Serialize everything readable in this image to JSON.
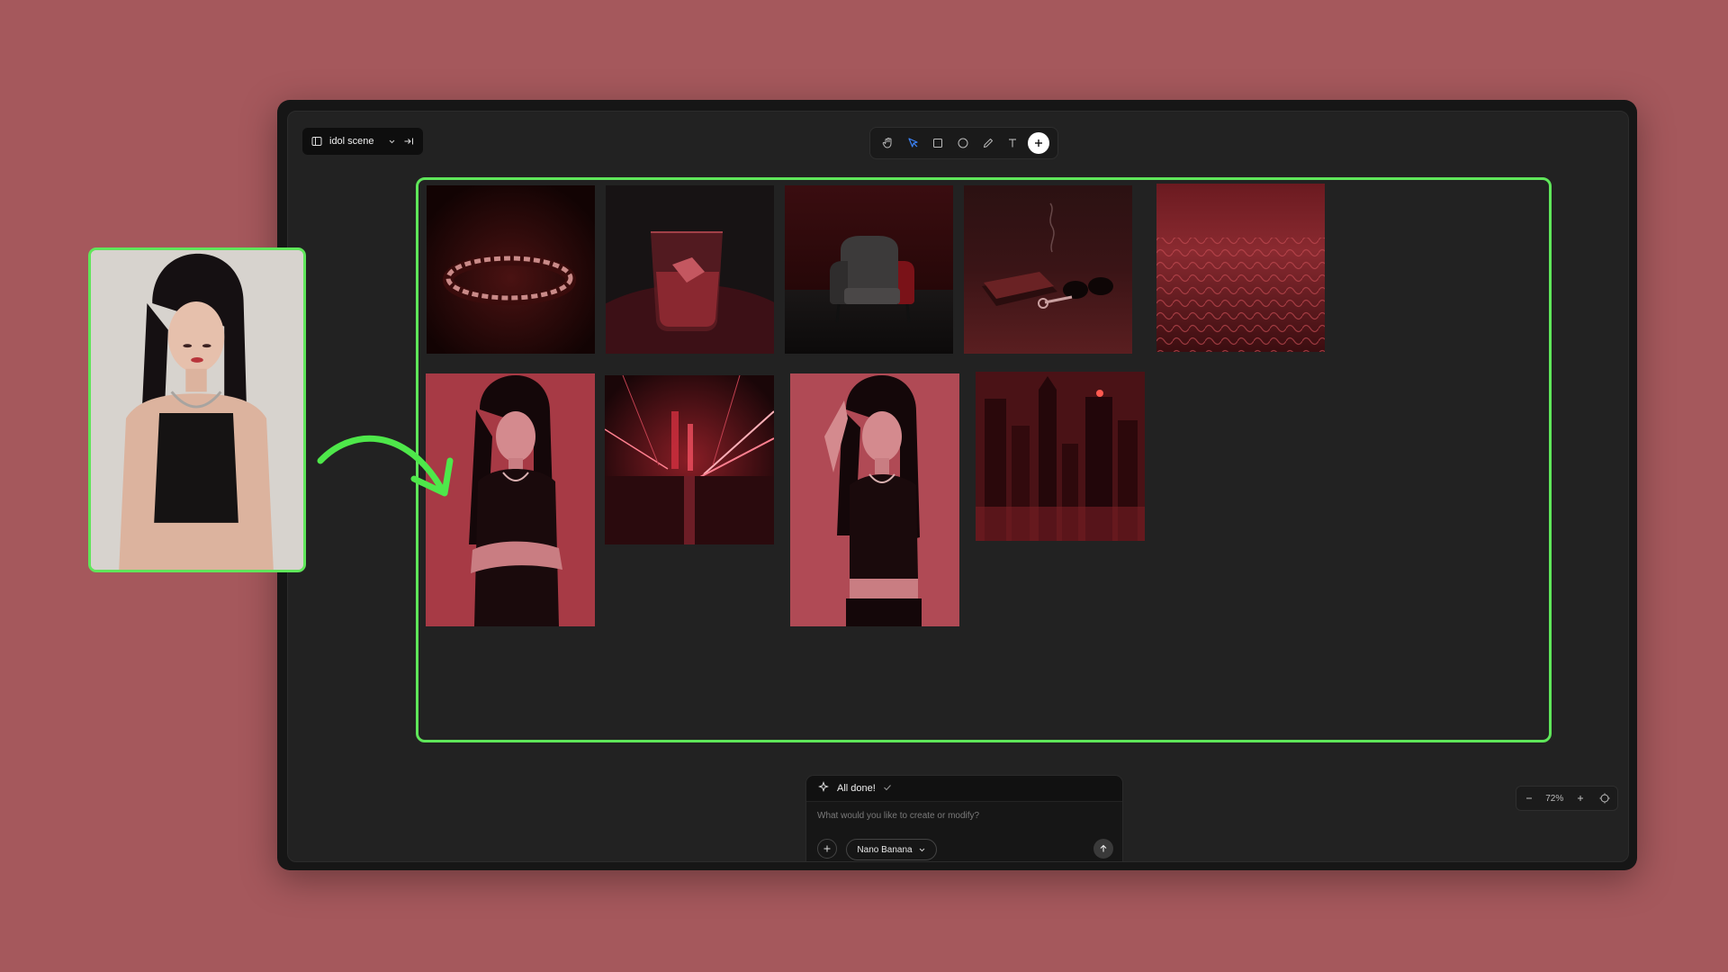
{
  "project": {
    "name": "idol scene"
  },
  "toolbar": {
    "tools": [
      "hand-icon",
      "pointer-icon",
      "rectangle-icon",
      "ellipse-icon",
      "pencil-icon",
      "text-icon",
      "plus-icon"
    ],
    "active_tool": "pointer-icon"
  },
  "chat": {
    "status": "All done!",
    "placeholder": "What would you like to create or modify?",
    "model": "Nano Banana"
  },
  "zoom": {
    "level": "72%"
  },
  "canvas_images": [
    "chain-bracelet",
    "whiskey-glass",
    "armchair",
    "wallet-sunglasses-keys",
    "red-texture",
    "woman-arms-crossed",
    "neon-city-street",
    "woman-hand-on-head",
    "city-skyline"
  ],
  "colors": {
    "background": "#a5585c",
    "selection": "#5fe65a",
    "canvas": "#222222",
    "accent": "#3b82f6"
  }
}
